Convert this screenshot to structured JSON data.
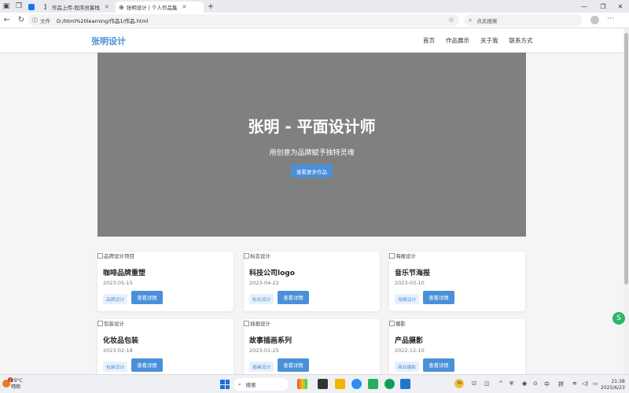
{
  "browser": {
    "tabs": [
      {
        "label": "",
        "state": "partial"
      },
      {
        "label": "作品上传-程序员客栈",
        "state": "inactive"
      },
      {
        "label": "张明设计 | 个人作品集",
        "state": "active"
      }
    ],
    "address": {
      "scheme_label": "文件",
      "url": "D:/html%20learning/作品1/作品.html"
    },
    "search_placeholder": "点此搜索"
  },
  "site": {
    "logo": "张明设计",
    "nav": [
      "首页",
      "作品展示",
      "关于我",
      "联系方式"
    ],
    "hero": {
      "title": "张明 - 平面设计师",
      "subtitle": "用创意为品牌赋予独特灵魂",
      "cta": "查看更多作品"
    },
    "detail_label": "查看详情",
    "works": [
      {
        "img_alt": "品牌设计项目",
        "title": "咖啡品牌重塑",
        "date": "2023-05-15",
        "tag": "品牌设计"
      },
      {
        "img_alt": "标志设计",
        "title": "科技公司logo",
        "date": "2023-04-22",
        "tag": "标志设计"
      },
      {
        "img_alt": "海报设计",
        "title": "音乐节海报",
        "date": "2023-03-10",
        "tag": "海报设计"
      },
      {
        "img_alt": "包装设计",
        "title": "化妆品包装",
        "date": "2023-02-18",
        "tag": "包装设计"
      },
      {
        "img_alt": "插画设计",
        "title": "故事插画系列",
        "date": "2023-01-25",
        "tag": "插画设计"
      },
      {
        "img_alt": "摄影",
        "title": "产品摄影",
        "date": "2022-12-10",
        "tag": "商业摄影"
      }
    ]
  },
  "taskbar": {
    "weather_temp": "29°C",
    "weather_desc": "晴朗",
    "weather_badge": "2",
    "search_label": "搜索",
    "tray_ime_1": "中",
    "tray_ime_2": "拼",
    "time": "21:38",
    "date": "2025/6/23"
  },
  "colors": {
    "accent": "#4a90d9",
    "hero_bg": "#808080",
    "tag_bg": "#e8f0fb"
  }
}
